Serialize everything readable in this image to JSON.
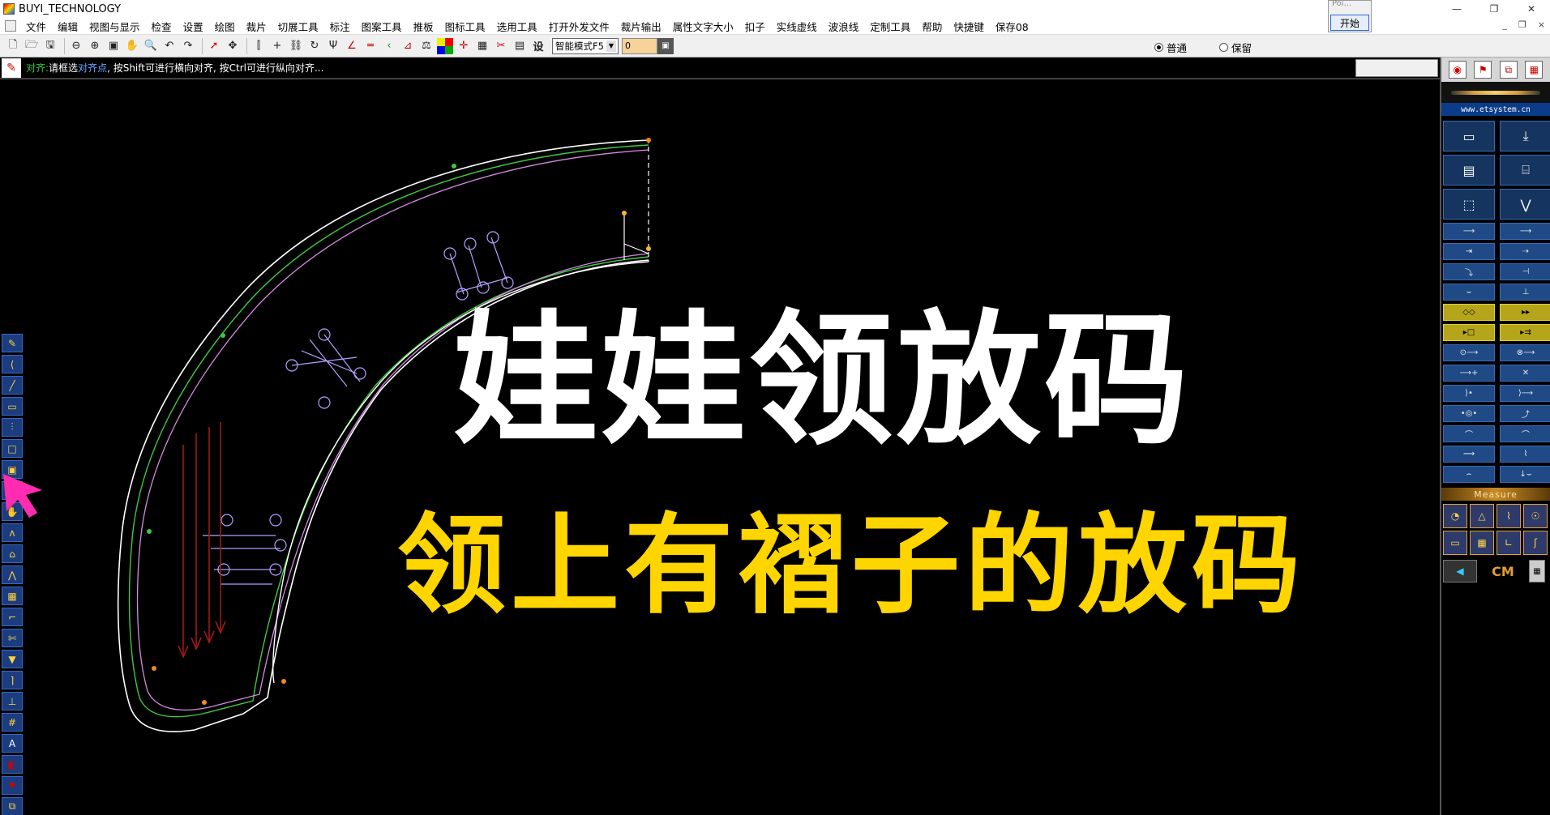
{
  "window": {
    "title": "BUYI_TECHNOLOGY",
    "popup_text": "Poi...",
    "popup_button": "开始",
    "controls": [
      "—",
      "❐",
      "✕"
    ]
  },
  "menu": {
    "items": [
      "文件",
      "编辑",
      "视图与显示",
      "检查",
      "设置",
      "绘图",
      "裁片",
      "切展工具",
      "标注",
      "图案工具",
      "推板",
      "图标工具",
      "选用工具",
      "打开外发文件",
      "裁片输出",
      "属性文字大小",
      "扣子",
      "实线虚线",
      "波浪线",
      "定制工具",
      "帮助",
      "快捷键",
      "保存08"
    ],
    "mdi_controls": [
      "_",
      "❐",
      "×"
    ]
  },
  "toolbar": {
    "mode_value": "智能模式F5",
    "number_value": "0",
    "radio_normal": "普通",
    "radio_keep": "保留"
  },
  "status": {
    "label": "对齐:",
    "prompt_a": "请框选",
    "prompt_highlight": "对齐点",
    "prompt_b": ", 按Shift可进行横向对齐, 按Ctrl可进行纵向对齐..."
  },
  "right_panel": {
    "site": "www.etsystem.cn",
    "measure_label": "Measure",
    "unit_label": "CM"
  },
  "captions": {
    "main": "娃娃领放码",
    "sub": "领上有褶子的放码"
  },
  "colors": {
    "canvas_bg": "#000000",
    "caption_main": "#ffffff",
    "caption_sub": "#ffd500",
    "pattern_line": "#ffffff",
    "grade_line_green": "#3ec93e",
    "grade_line_magenta": "#d58be0",
    "arrow_red": "#a01818",
    "cursor_pink": "#ff2bb0"
  },
  "icons": {
    "new": "new-file-icon",
    "open": "open-folder-icon",
    "save": "save-icon",
    "zoom_out": "zoom-out-icon",
    "zoom_in": "zoom-in-icon",
    "pan": "hand-icon",
    "undo": "undo-icon",
    "redo": "redo-icon"
  }
}
